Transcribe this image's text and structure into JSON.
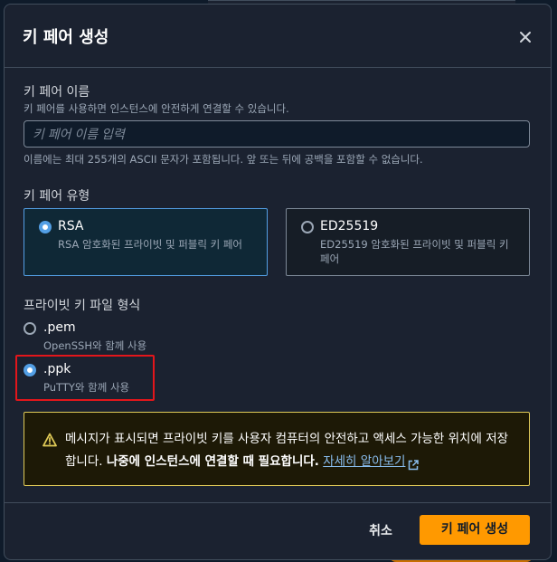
{
  "modal": {
    "title": "키 페어 생성",
    "close_icon": "close-icon"
  },
  "key_pair_name": {
    "label": "키 페어 이름",
    "description": "키 페어를 사용하면 인스턴스에 안전하게 연결할 수 있습니다.",
    "value": "",
    "placeholder": "키 페어 이름 입력",
    "constraint": "이름에는 최대 255개의 ASCII 문자가 포함됩니다. 앞 또는 뒤에 공백을 포함할 수 없습니다."
  },
  "key_pair_type": {
    "label": "키 페어 유형",
    "options": [
      {
        "title": "RSA",
        "description": "RSA 암호화된 프라이빗 및 퍼블릭 키 페어",
        "selected": true
      },
      {
        "title": "ED25519",
        "description": "ED25519 암호화된 프라이빗 및 퍼블릭 키 페어",
        "selected": false
      }
    ]
  },
  "private_key_format": {
    "label": "프라이빗 키 파일 형식",
    "options": [
      {
        "title": ".pem",
        "description": "OpenSSH와 함께 사용",
        "selected": false
      },
      {
        "title": ".ppk",
        "description": "PuTTY와 함께 사용",
        "selected": true
      }
    ]
  },
  "warning": {
    "icon": "warning-icon",
    "text_part1": "메시지가 표시되면 프라이빗 키를 사용자 컴퓨터의 안전하고 액세스 가능한 위치에 저장합니다. ",
    "text_bold": "나중에 인스턴스에 연결할 때 필요합니다.",
    "link_label": "자세히 알아보기",
    "link_icon": "external-link-icon"
  },
  "footer": {
    "cancel_label": "취소",
    "create_label": "키 페어 생성"
  },
  "colors": {
    "accent": "#539fe5",
    "primary_button": "#ff9900",
    "warning_border": "#e0ca57",
    "highlight": "#e3161b"
  }
}
